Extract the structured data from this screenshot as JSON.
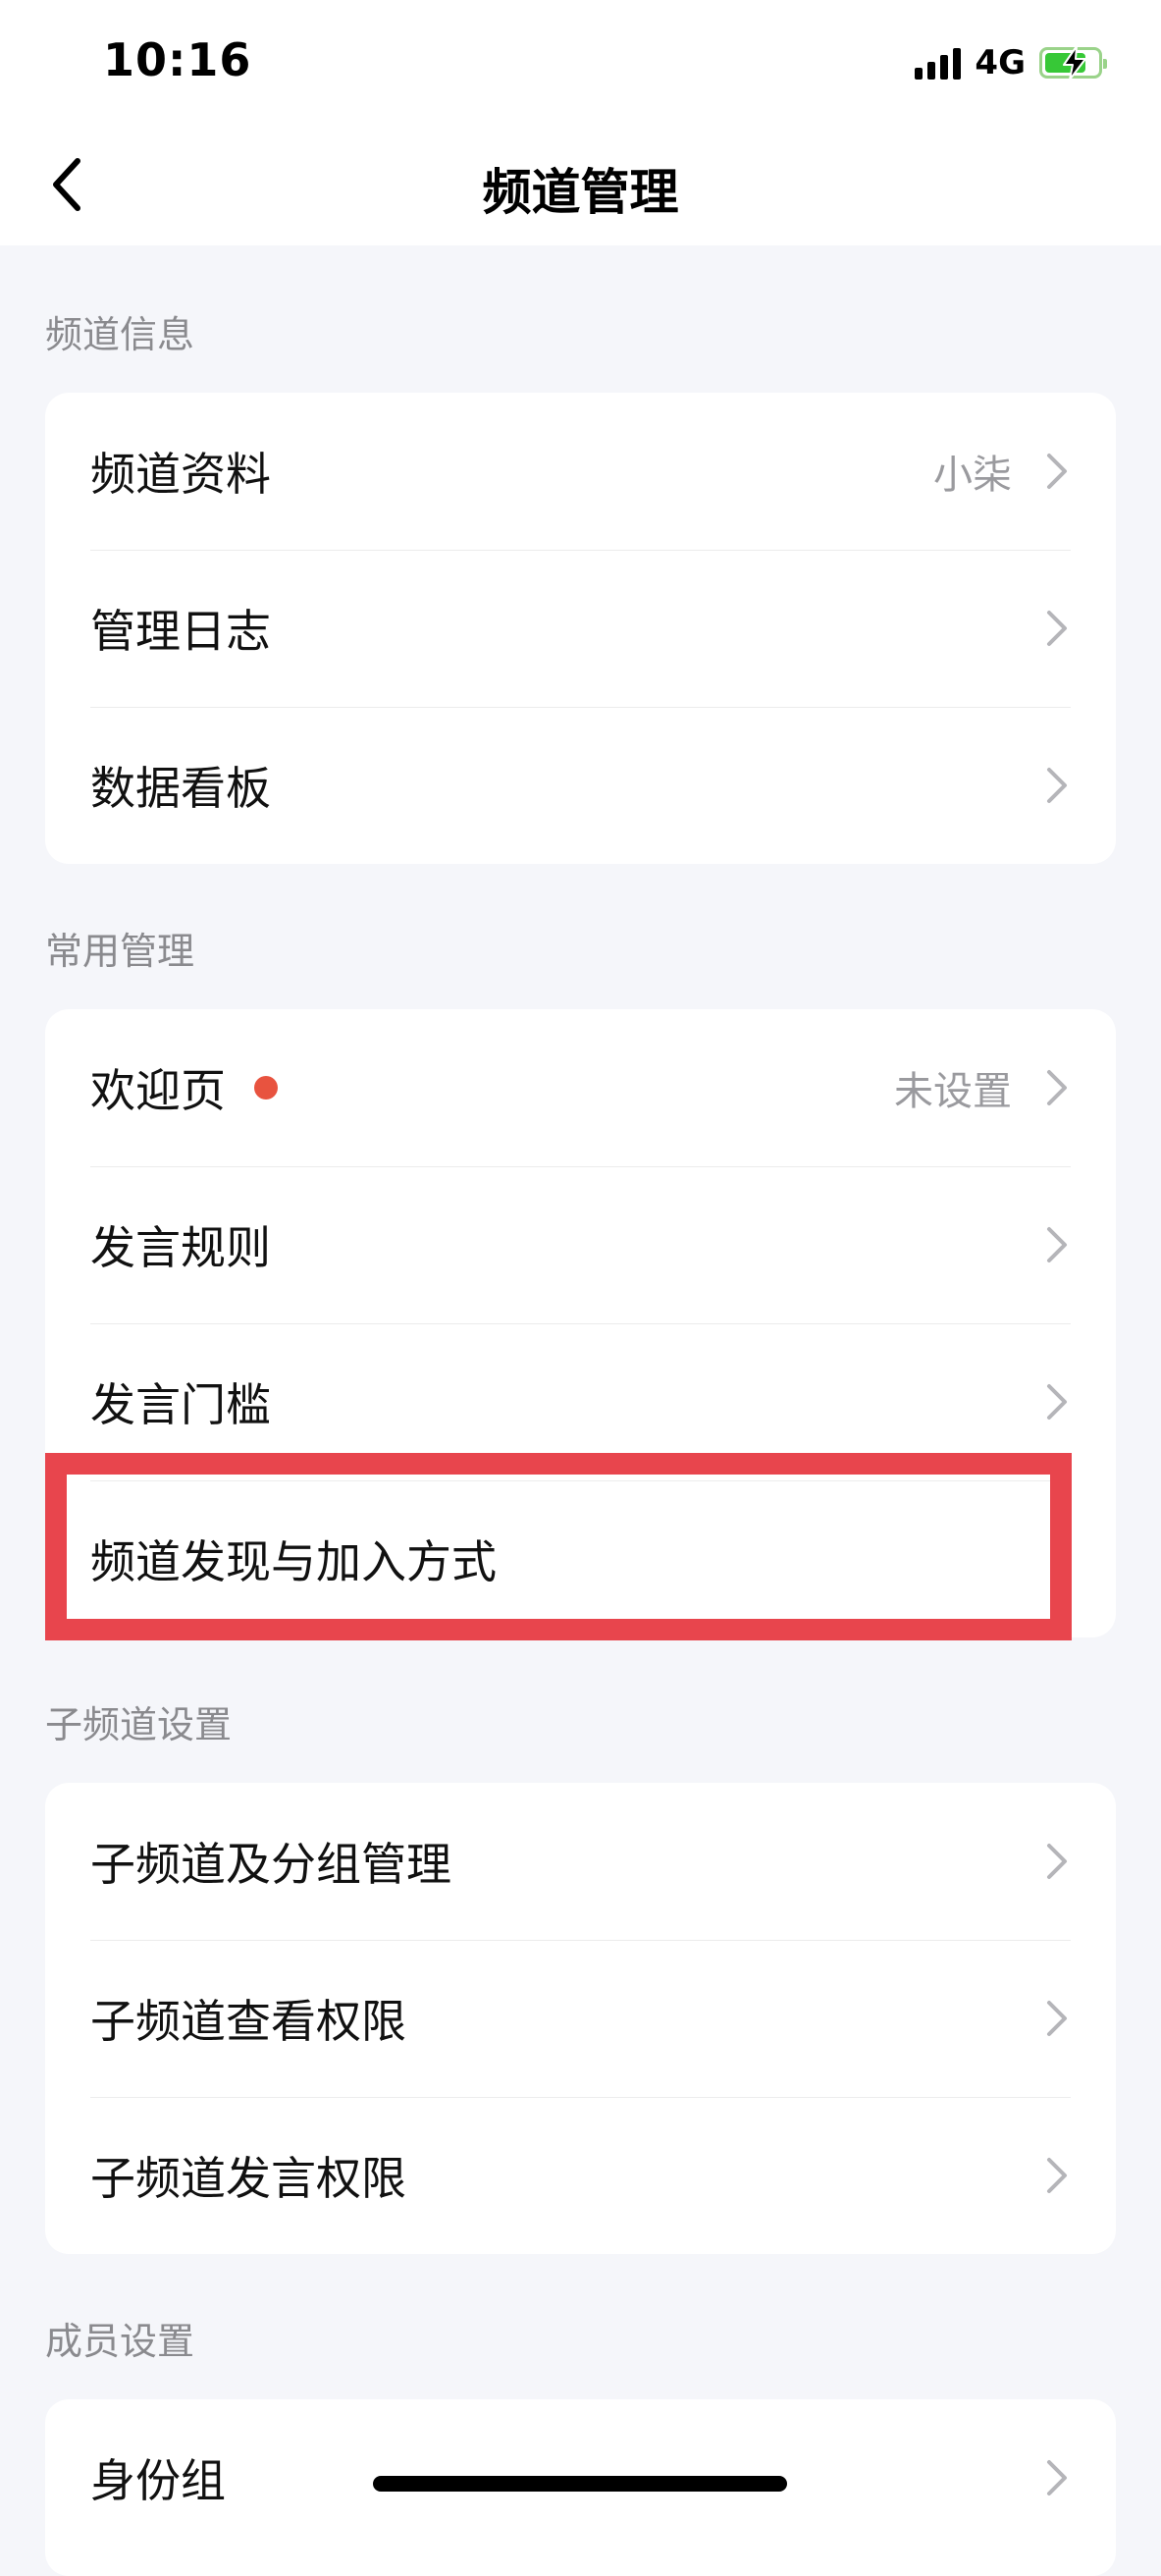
{
  "status_bar": {
    "time": "10:16",
    "network": "4G"
  },
  "nav": {
    "title": "频道管理"
  },
  "sections": [
    {
      "header": "频道信息",
      "items": [
        {
          "label": "频道资料",
          "value": "小柒"
        },
        {
          "label": "管理日志",
          "value": ""
        },
        {
          "label": "数据看板",
          "value": ""
        }
      ]
    },
    {
      "header": "常用管理",
      "items": [
        {
          "label": "欢迎页",
          "value": "未设置"
        },
        {
          "label": "发言规则",
          "value": ""
        },
        {
          "label": "发言门槛",
          "value": ""
        },
        {
          "label": "频道发现与加入方式",
          "value": ""
        }
      ]
    },
    {
      "header": "子频道设置",
      "items": [
        {
          "label": "子频道及分组管理",
          "value": ""
        },
        {
          "label": "子频道查看权限",
          "value": ""
        },
        {
          "label": "子频道发言权限",
          "value": ""
        }
      ]
    },
    {
      "header": "成员设置",
      "items": [
        {
          "label": "身份组",
          "value": ""
        }
      ]
    }
  ],
  "colors": {
    "accent_highlight": "#e8454d",
    "badge_red": "#e8533f",
    "background": "#f5f6fa"
  }
}
